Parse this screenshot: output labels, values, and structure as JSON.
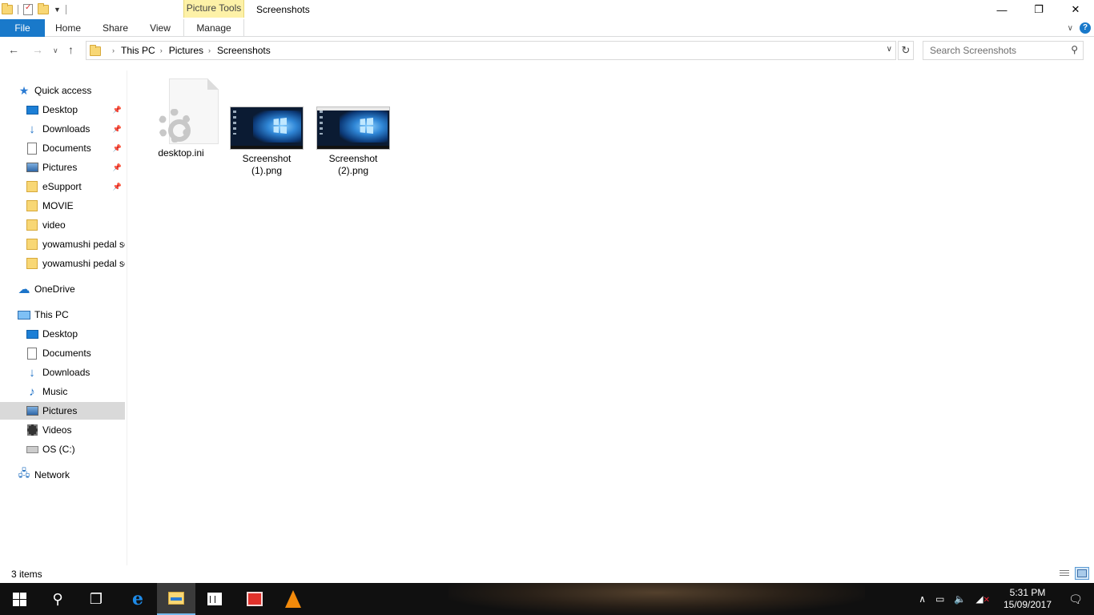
{
  "window": {
    "title": "Screenshots",
    "contextual_tab_group": "Picture Tools",
    "minimize": "—",
    "restore": "❐",
    "close": "✕"
  },
  "ribbon": {
    "tabs": [
      {
        "label": "File"
      },
      {
        "label": "Home"
      },
      {
        "label": "Share"
      },
      {
        "label": "View"
      },
      {
        "label": "Manage"
      }
    ],
    "expand_icon": "chevron-down-icon",
    "help_label": "?"
  },
  "addressbar": {
    "breadcrumbs": [
      "This PC",
      "Pictures",
      "Screenshots"
    ],
    "search_placeholder": "Search Screenshots"
  },
  "navpane": {
    "quick_access": {
      "label": "Quick access"
    },
    "quick_items": [
      {
        "label": "Desktop",
        "pinned": true
      },
      {
        "label": "Downloads",
        "pinned": true
      },
      {
        "label": "Documents",
        "pinned": true
      },
      {
        "label": "Pictures",
        "pinned": true
      },
      {
        "label": "eSupport",
        "pinned": true
      },
      {
        "label": "MOVIE"
      },
      {
        "label": "video"
      },
      {
        "label": "yowamushi pedal se"
      },
      {
        "label": "yowamushi pedal se"
      }
    ],
    "onedrive": {
      "label": "OneDrive"
    },
    "this_pc": {
      "label": "This PC"
    },
    "pc_items": [
      {
        "label": "Desktop"
      },
      {
        "label": "Documents"
      },
      {
        "label": "Downloads"
      },
      {
        "label": "Music"
      },
      {
        "label": "Pictures",
        "selected": true
      },
      {
        "label": "Videos"
      },
      {
        "label": "OS (C:)"
      }
    ],
    "network": {
      "label": "Network"
    }
  },
  "files": [
    {
      "name": "desktop.ini",
      "type": "settings-file"
    },
    {
      "name_line1": "Screenshot",
      "name_line2": "(1).png",
      "type": "image"
    },
    {
      "name_line1": "Screenshot",
      "name_line2": "(2).png",
      "type": "image"
    }
  ],
  "status": {
    "item_count": "3 items"
  },
  "taskbar": {
    "time": "5:31 PM",
    "date": "15/09/2017",
    "accent": "#76b9ed"
  }
}
